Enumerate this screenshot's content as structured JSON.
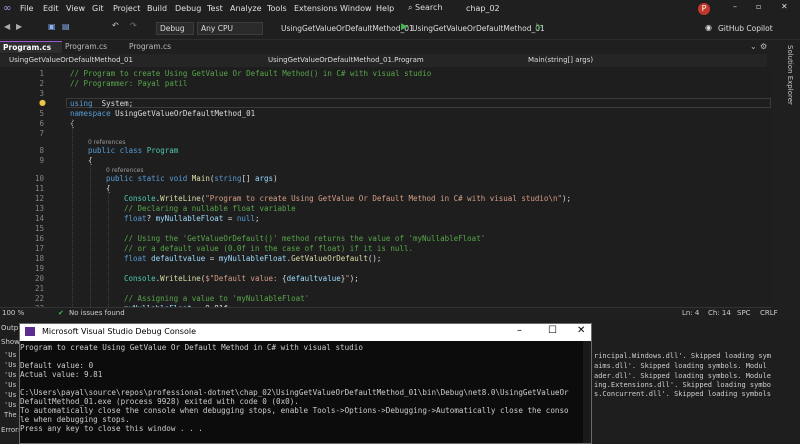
{
  "menu": [
    "File",
    "Edit",
    "View",
    "Git",
    "Project",
    "Build",
    "Debug",
    "Test",
    "Analyze",
    "Tools",
    "Extensions",
    "Window",
    "Help"
  ],
  "search_label": "Search",
  "solution_name": "chap_02",
  "avatar_letter": "P",
  "toolbar": {
    "config": "Debug",
    "platform": "Any CPU",
    "startup_project": "UsingGetValueOrDefaultMethod_01",
    "run_label": "UsingGetValueOrDefaultMethod_01",
    "copilot": "GitHub Copilot"
  },
  "tabs": [
    {
      "label": "Program.cs",
      "active": true
    },
    {
      "label": "Program.cs",
      "active": false
    },
    {
      "label": "Program.cs",
      "active": false
    }
  ],
  "navbar": {
    "project": "UsingGetValueOrDefaultMethod_01",
    "class": "UsingGetValueOrDefaultMethod_01.Program",
    "member": "Main(string[] args)"
  },
  "solution_explorer": "Solution Explorer",
  "editor": {
    "line_numbers": [
      "1",
      "2",
      "3",
      "4",
      "5",
      "6",
      "7",
      "8",
      "9",
      "10",
      "11",
      "12",
      "13",
      "14",
      "15",
      "16",
      "17",
      "18",
      "19",
      "20",
      "21",
      "22",
      "23"
    ],
    "refs": "0 references"
  },
  "statusbar": {
    "zoom": "100 %",
    "issues": "No issues found",
    "line": "Ln: 4",
    "col": "Ch: 14",
    "spc": "SPC",
    "crlf": "CRLF"
  },
  "output_panel": {
    "label": "Outp",
    "show": "Show",
    "lines": [
      "rincipal.Windows.dll'. Skipped loading sym",
      "aims.dll'. Skipped loading symbols. Modul",
      "ader.dll'. Skipped loading symbols. Module",
      "ing.Extensions.dll'. Skipped loading symbo",
      "s.Concurrent.dll'. Skipped loading symbols"
    ],
    "left_fragments": [
      "'Us",
      "'Us",
      "'Us",
      "'Us",
      "'Us",
      "'Us",
      "The"
    ],
    "error_tab": "Errors"
  },
  "console": {
    "title": "Microsoft Visual Studio Debug Console",
    "lines": [
      "Program to create Using GetValue Or Default Method in C# with visual studio",
      "",
      "Default value: 0",
      "Actual value: 9.81",
      "",
      "C:\\Users\\payal\\source\\repos\\professional-dotnet\\chap_02\\UsingGetValueOrDefaultMethod_01\\bin\\Debug\\net8.0\\UsingGetValueOr",
      "DefaultMethod_01.exe (process 9928) exited with code 0 (0x0).",
      "To automatically close the console when debugging stops, enable Tools->Options->Debugging->Automatically close the conso",
      "le when debugging stops.",
      "Press any key to close this window . . ."
    ]
  },
  "colors": {
    "keyword": "#569cd6",
    "type": "#4ec9b0",
    "comment": "#57a64a",
    "string": "#d69d85",
    "method": "#dcdcaa",
    "variable": "#9cdcfe",
    "profile": "#c0392b"
  }
}
